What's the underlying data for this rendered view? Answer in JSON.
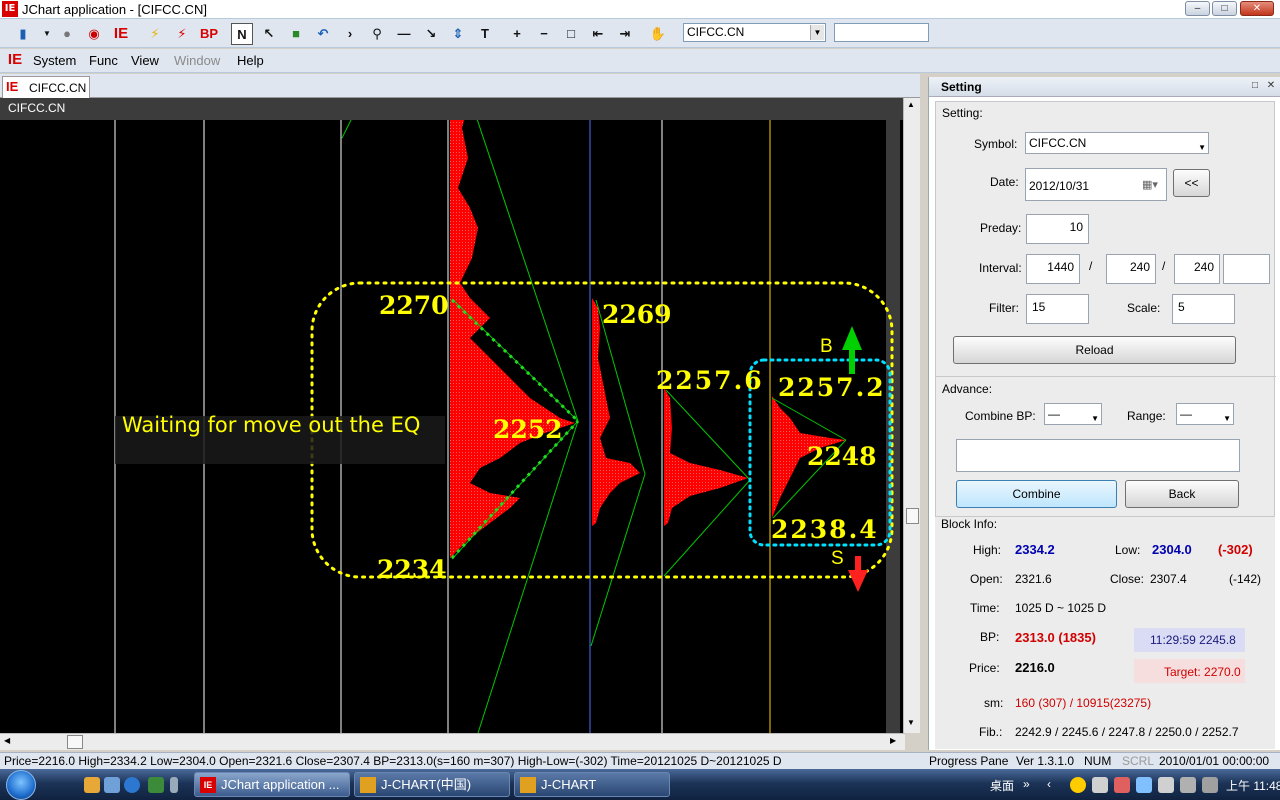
{
  "window": {
    "title": "JChart application - [CIFCC.CN]",
    "logo": "IE"
  },
  "toolbar": {
    "symbol": "CIFCC.CN",
    "glyph_bp": "BP",
    "glyph_n": "N",
    "glyph_t": "T"
  },
  "menu": {
    "items": [
      "System",
      "Func",
      "View",
      "Window",
      "Help"
    ]
  },
  "document": {
    "tab": "CIFCC.CN",
    "chart_label": "CIFCC.CN"
  },
  "chart": {
    "annotation": "Waiting for move out the EQ",
    "levels": {
      "l2270": "2270",
      "l2269": "2269",
      "l2252": "2252",
      "l2234": "2234",
      "l2257_6": "2257.6",
      "l2257_2": "2257.2",
      "l2248": "2248",
      "l2238_4": "2238.4"
    },
    "signal_b": "B",
    "signal_s": "S",
    "colors": {
      "background": "#000000",
      "profile": "#ff0000",
      "lines": "#00c800",
      "labels": "#ffff00",
      "dotted_box": "#ffff00",
      "cyan_box": "#00e0ff"
    }
  },
  "panel": {
    "title": "Setting",
    "section_setting": "Setting:",
    "symbol_label": "Symbol:",
    "symbol_value": "CIFCC.CN",
    "date_label": "Date:",
    "date_value": "2012/10/31",
    "back_arrows": "<<",
    "preday_label": "Preday:",
    "preday_value": "10",
    "interval_label": "Interval:",
    "interval_1": "1440",
    "interval_2": "240",
    "interval_3": "240",
    "sep": "/",
    "filter_label": "Filter:",
    "filter_value": "15",
    "scale_label": "Scale:",
    "scale_value": "5",
    "reload": "Reload",
    "section_advance": "Advance:",
    "combine_bp_label": "Combine BP:",
    "combine_bp_value": "—",
    "range_label": "Range:",
    "range_value": "—",
    "combine_btn": "Combine",
    "back_btn": "Back",
    "section_block": "Block Info:",
    "high_label": "High:",
    "high_value": "2334.2",
    "low_label": "Low:",
    "low_value": "2304.0",
    "low_diff": "(-302)",
    "open_label": "Open:",
    "open_value": "2321.6",
    "close_label": "Close:",
    "close_value": "2307.4",
    "close_diff": "(-142)",
    "time_label": "Time:",
    "time_value": "1025 D ~ 1025 D",
    "bp_label": "BP:",
    "bp_value": "2313.0 (1835)",
    "bp_time": "11:29:59  2245.8",
    "price_label": "Price:",
    "price_value": "2216.0",
    "target": "Target: 2270.0",
    "sm_label": "sm:",
    "sm_value": "160 (307) / 10915(23275)",
    "fib_label": "Fib.:",
    "fib_value": "2242.9 / 2245.6 / 2247.8 / 2250.0 / 2252.7"
  },
  "statusbar": {
    "info": "Price=2216.0  High=2334.2  Low=2304.0  Open=2321.6  Close=2307.4  BP=2313.0(s=160 m=307)  High-Low=(-302)  Time=20121025 D~20121025 D",
    "progress": "Progress Pane",
    "version": "Ver 1.3.1.0",
    "num": "NUM",
    "scrl": "SCRL",
    "datetime": "2010/01/01 00:00:00"
  },
  "taskbar": {
    "tasks": [
      "JChart application ...",
      "J-CHART(中国)",
      "J-CHART"
    ],
    "desktop": "桌面",
    "clock": "上午 11:48"
  }
}
